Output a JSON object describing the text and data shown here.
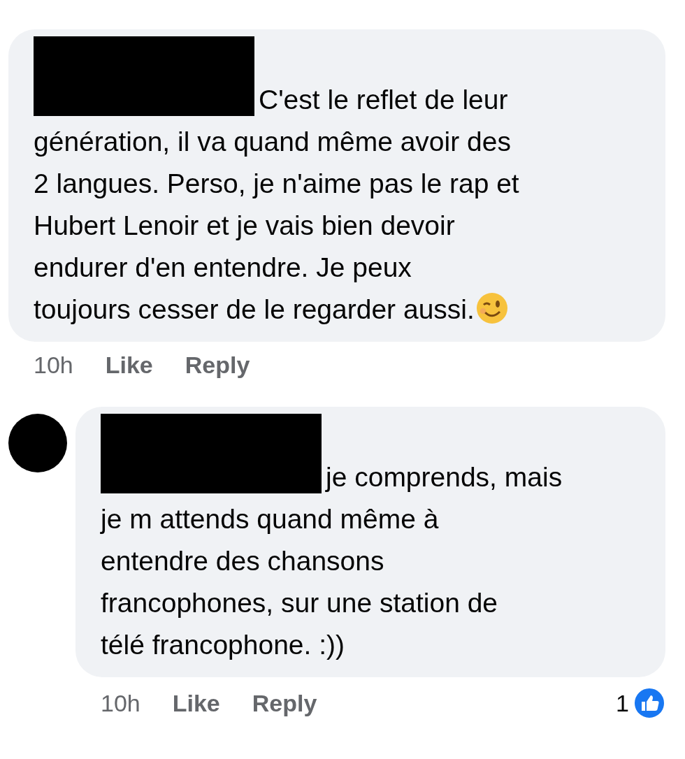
{
  "comments": [
    {
      "has_avatar": false,
      "lines": [
        "C'est le reflet de leur",
        "génération, il va quand même avoir des",
        "2 langues. Perso, je n'aime pas le rap et",
        "Hubert Lenoir et je vais bien devoir",
        "endurer d'en entendre. Je peux",
        "toujours cesser de le regarder aussi."
      ],
      "emoji": true,
      "time": "10h",
      "actions": [
        "Like",
        "Reply"
      ]
    },
    {
      "has_avatar": true,
      "lines": [
        "je comprends, mais",
        "je m attends quand même à",
        "entendre des chansons",
        "francophones, sur une station de",
        "télé francophone. :))"
      ],
      "emoji": false,
      "time": "10h",
      "actions": [
        "Like",
        "Reply"
      ],
      "reactions": "1"
    }
  ]
}
